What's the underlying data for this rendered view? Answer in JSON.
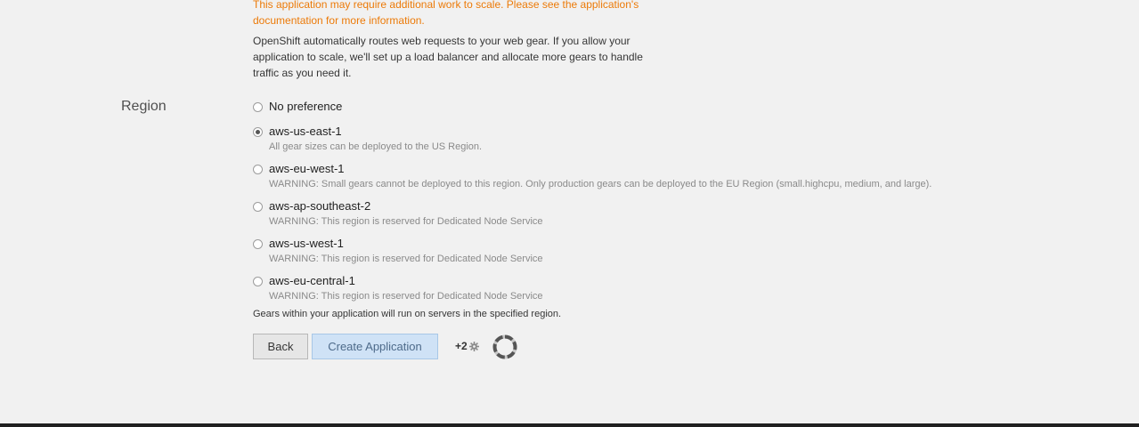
{
  "scaling": {
    "warning": "This application may require additional work to scale. Please see the application's documentation for more information.",
    "description": "OpenShift automatically routes web requests to your web gear. If you allow your application to scale, we'll set up a load balancer and allocate more gears to handle traffic as you need it."
  },
  "region": {
    "label": "Region",
    "options": [
      {
        "label": "No preference",
        "help": "",
        "checked": false
      },
      {
        "label": "aws-us-east-1",
        "help": "All gear sizes can be deployed to the US Region.",
        "checked": true
      },
      {
        "label": "aws-eu-west-1",
        "help": "WARNING: Small gears cannot be deployed to this region. Only production gears can be deployed to the EU Region (small.highcpu, medium, and large).",
        "checked": false
      },
      {
        "label": "aws-ap-southeast-2",
        "help": "WARNING: This region is reserved for Dedicated Node Service",
        "checked": false
      },
      {
        "label": "aws-us-west-1",
        "help": "WARNING: This region is reserved for Dedicated Node Service",
        "checked": false
      },
      {
        "label": "aws-eu-central-1",
        "help": "WARNING: This region is reserved for Dedicated Node Service",
        "checked": false
      }
    ],
    "note": "Gears within your application will run on servers in the specified region."
  },
  "actions": {
    "back_label": "Back",
    "create_label": "Create Application",
    "gear_count": "+2",
    "gear_icon": "gear-icon",
    "spinner_icon": "loading-spinner-icon"
  }
}
